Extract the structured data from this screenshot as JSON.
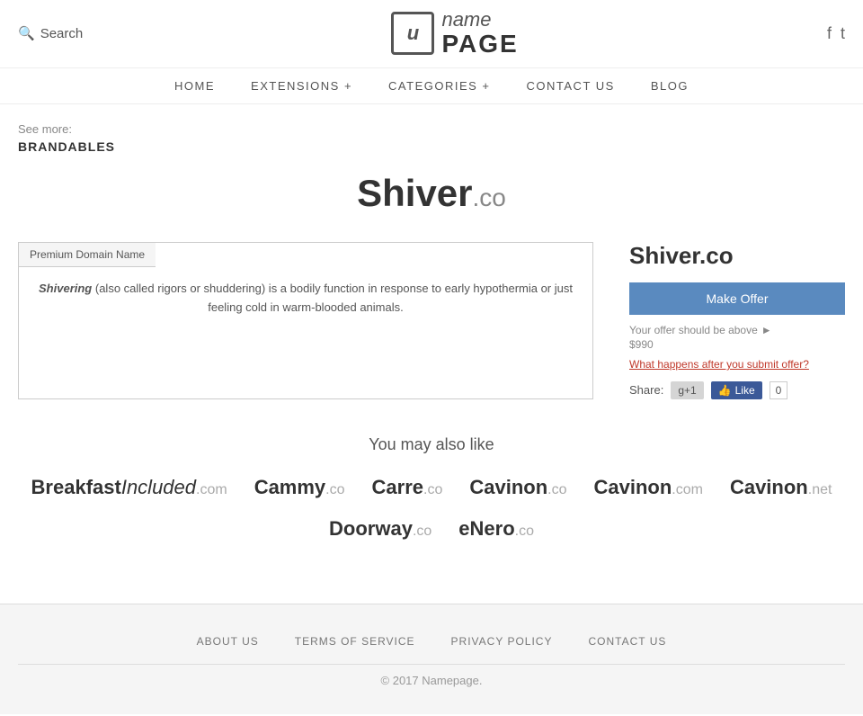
{
  "header": {
    "search_label": "Search",
    "logo_icon": "u",
    "logo_name": "name",
    "logo_page": "PAGE",
    "social": [
      "f",
      "t"
    ]
  },
  "nav": {
    "items": [
      {
        "label": "HOME",
        "has_plus": false
      },
      {
        "label": "EXTENSIONS +",
        "has_plus": false
      },
      {
        "label": "CATEGORIES +",
        "has_plus": false
      },
      {
        "label": "CONTACT US",
        "has_plus": false
      },
      {
        "label": "BLOG",
        "has_plus": false
      }
    ]
  },
  "breadcrumb": {
    "see_more": "See more:",
    "category": "BRANDABLES"
  },
  "domain": {
    "name": "Shiver",
    "tld": ".co",
    "full": "Shiver.co",
    "tab_label": "Premium Domain Name",
    "description_italic": "Shivering",
    "description_rest": " (also called rigors or shuddering) is a bodily function in response to early hypothermia or just feeling cold in warm-blooded animals.",
    "offer_button": "Make Offer",
    "offer_hint": "Your offer should be above",
    "offer_price": "$990",
    "offer_link": "What happens after you submit offer?",
    "share_label": "Share:",
    "share_g1": "g+1",
    "share_fb": "Like",
    "share_count": "0"
  },
  "also_like": {
    "title": "You may also like",
    "items": [
      {
        "main": "Breakfast",
        "italic": "Included",
        "tld": ".com"
      },
      {
        "main": "Cammy",
        "italic": "",
        "tld": ".co"
      },
      {
        "main": "Carre",
        "italic": "",
        "tld": ".co"
      },
      {
        "main": "Cavinon",
        "italic": "",
        "tld": ".co"
      },
      {
        "main": "Cavinon",
        "italic": "",
        "tld": ".com"
      },
      {
        "main": "Cavinon",
        "italic": "",
        "tld": ".net"
      },
      {
        "main": "Doorway",
        "italic": "",
        "tld": ".co"
      },
      {
        "main": "eNero",
        "italic": "",
        "tld": ".co"
      }
    ]
  },
  "footer": {
    "links": [
      {
        "label": "ABOUT US"
      },
      {
        "label": "TERMS OF SERVICE"
      },
      {
        "label": "PRIVACY POLICY"
      },
      {
        "label": "CONTACT US"
      }
    ],
    "copyright": "© 2017 Namepage."
  }
}
